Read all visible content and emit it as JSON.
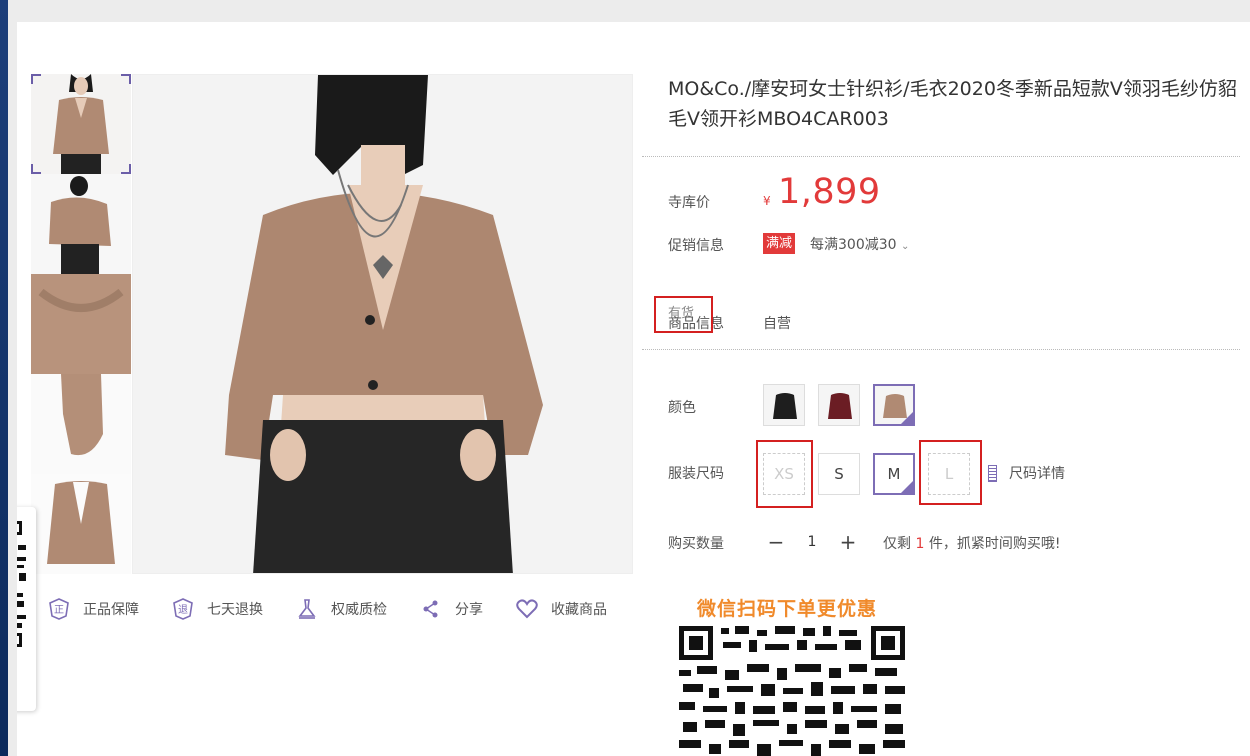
{
  "product": {
    "title": "MO&Co./摩安珂女士针织衫/毛衣2020冬季新品短款V领羽毛纱仿貂毛V领开衫MBO4CAR003",
    "price_label": "寺库价",
    "currency": "¥",
    "price": "1,899",
    "promo_label": "促销信息",
    "promo_tag": "满减",
    "promo_text": "每满300减30",
    "stock_label": "有货",
    "info_label": "商品信息",
    "info_value": "自营",
    "color_label": "颜色",
    "size_label": "服装尺码",
    "sizes": [
      "XS",
      "S",
      "M",
      "L"
    ],
    "size_detail": "尺码详情",
    "qty_label": "购买数量",
    "qty_value": "1",
    "stock_prefix": "仅剩 ",
    "stock_num": "1",
    "stock_suffix": " 件，抓紧时间购买哦!"
  },
  "services": [
    {
      "label": "正品保障",
      "icon": "authentic-icon"
    },
    {
      "label": "七天退换",
      "icon": "return-icon"
    },
    {
      "label": "权威质检",
      "icon": "inspection-icon"
    },
    {
      "label": "分享",
      "icon": "share-icon"
    },
    {
      "label": "收藏商品",
      "icon": "heart-icon"
    }
  ],
  "wechat": {
    "title": "微信扫码下单更优惠"
  },
  "float_tail": "!",
  "colors": {
    "accent": "#7d6db5",
    "price": "#e23a3a",
    "wechat": "#f08a2b"
  }
}
